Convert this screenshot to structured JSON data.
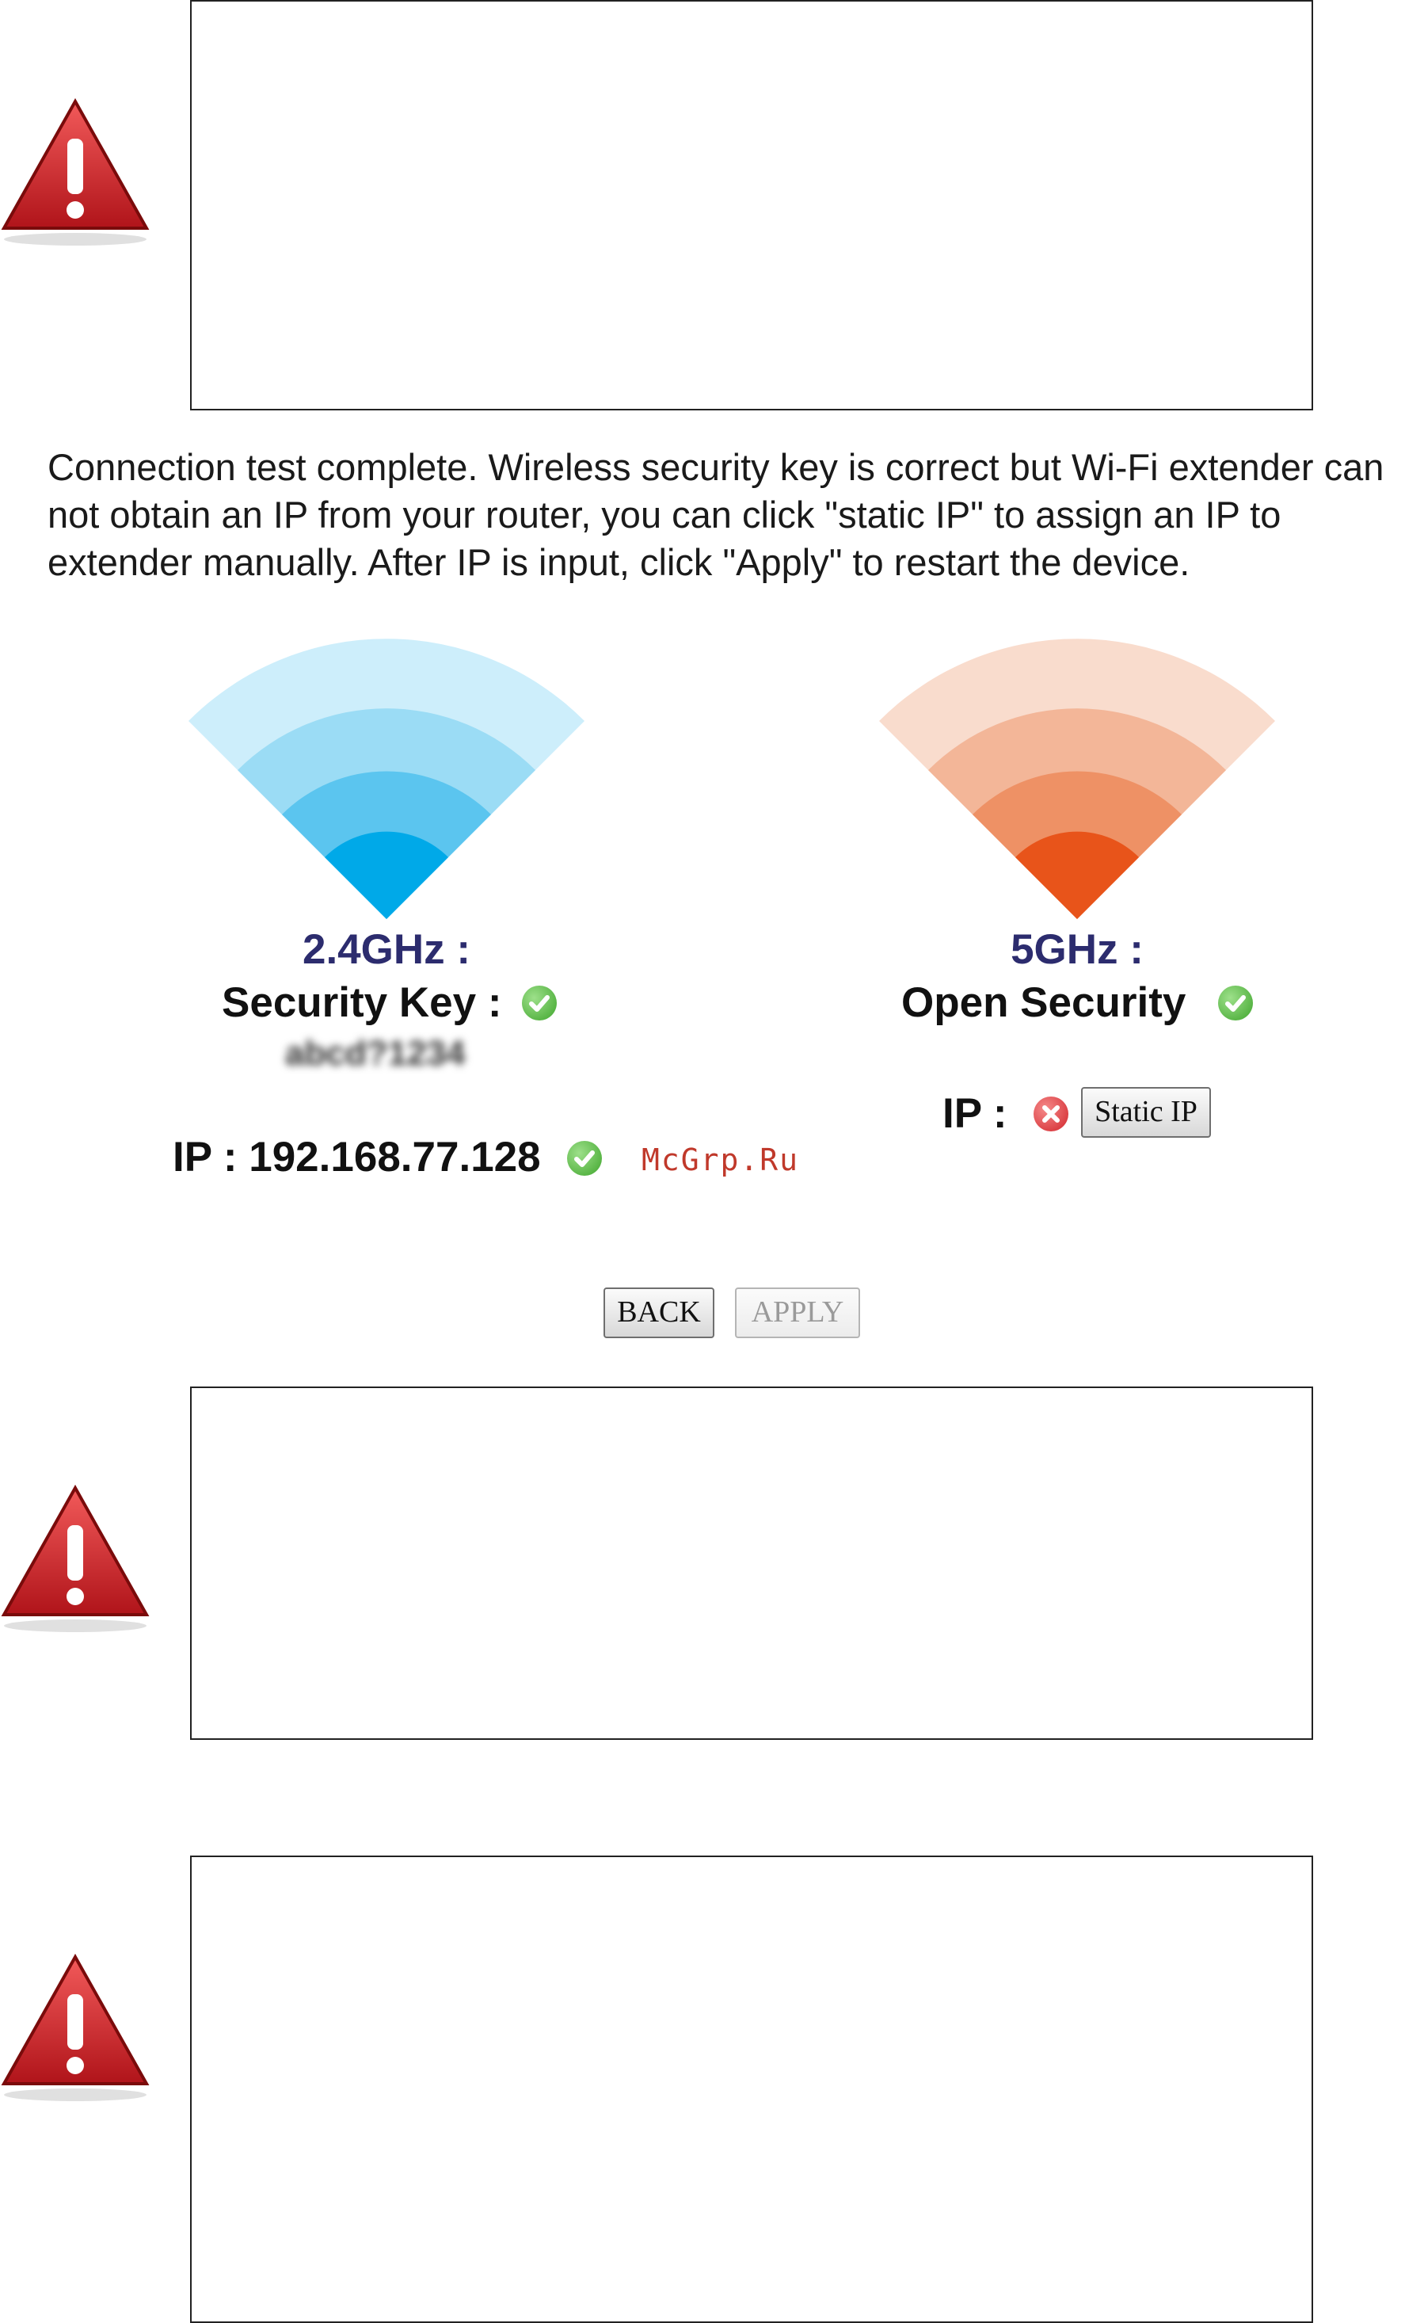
{
  "message": "Connection test complete. Wireless security key is correct but Wi-Fi extender can not obtain an IP from your router, you can click \"static IP\" to assign an IP to extender manually. After IP is input, click \"Apply\" to restart the device.",
  "band_24": {
    "label": "2.4GHz :",
    "security_label": "Security Key :",
    "security_key_blurred": "abcd?1234",
    "ip_label": "IP : 192.168.77.128",
    "color": "#00a9e8"
  },
  "band_5": {
    "label": "5GHz :",
    "security_label": "Open Security",
    "ip_label": "IP :",
    "static_ip_button": "Static IP",
    "color": "#e8541a"
  },
  "buttons": {
    "back": "BACK",
    "apply": "APPLY"
  },
  "watermark": "McGrp.Ru",
  "icons": {
    "warning": "warning-triangle-icon",
    "ok": "check-circle-icon",
    "error": "x-circle-icon"
  }
}
